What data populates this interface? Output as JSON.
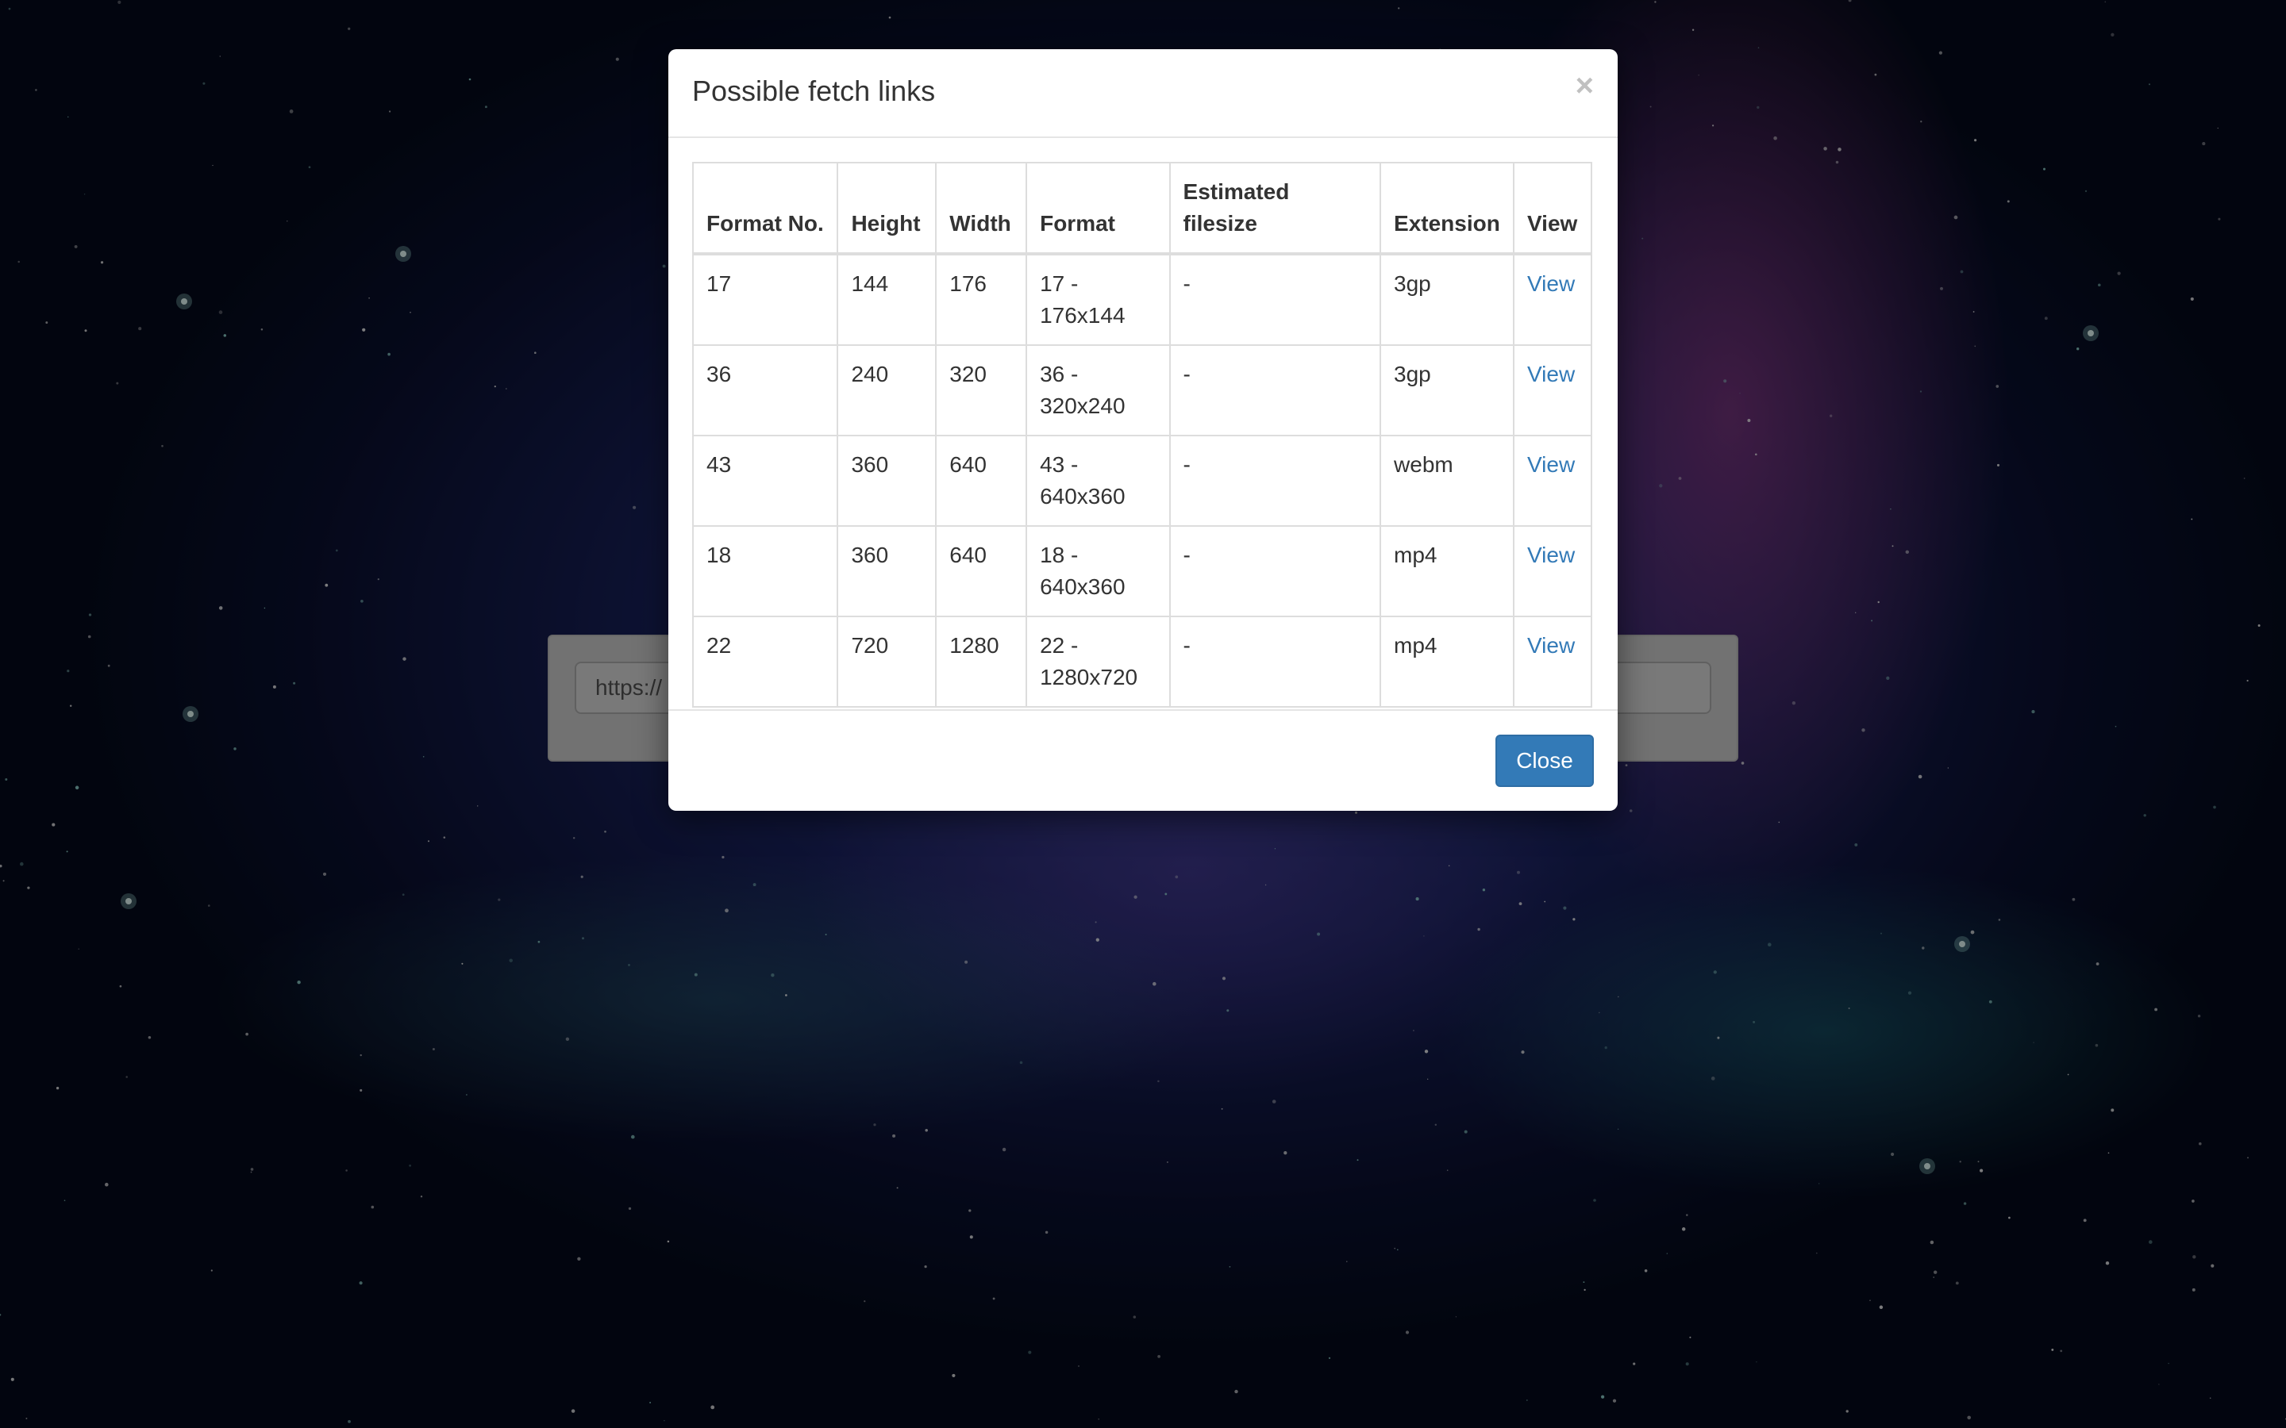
{
  "background": {
    "url_input_value": "https://"
  },
  "modal": {
    "title": "Possible fetch links",
    "close_symbol": "×",
    "footer_close_label": "Close",
    "table": {
      "headers": [
        "Format No.",
        "Height",
        "Width",
        "Format",
        "Estimated filesize",
        "Extension",
        "View"
      ],
      "rows": [
        {
          "format_no": "17",
          "height": "144",
          "width": "176",
          "format": "17 - 176x144",
          "filesize": "-",
          "extension": "3gp",
          "view": "View"
        },
        {
          "format_no": "36",
          "height": "240",
          "width": "320",
          "format": "36 - 320x240",
          "filesize": "-",
          "extension": "3gp",
          "view": "View"
        },
        {
          "format_no": "43",
          "height": "360",
          "width": "640",
          "format": "43 - 640x360",
          "filesize": "-",
          "extension": "webm",
          "view": "View"
        },
        {
          "format_no": "18",
          "height": "360",
          "width": "640",
          "format": "18 - 640x360",
          "filesize": "-",
          "extension": "mp4",
          "view": "View"
        },
        {
          "format_no": "22",
          "height": "720",
          "width": "1280",
          "format": "22 - 1280x720",
          "filesize": "-",
          "extension": "mp4",
          "view": "View"
        }
      ]
    }
  },
  "colors": {
    "primary": "#337ab7",
    "link": "#337ab7"
  }
}
